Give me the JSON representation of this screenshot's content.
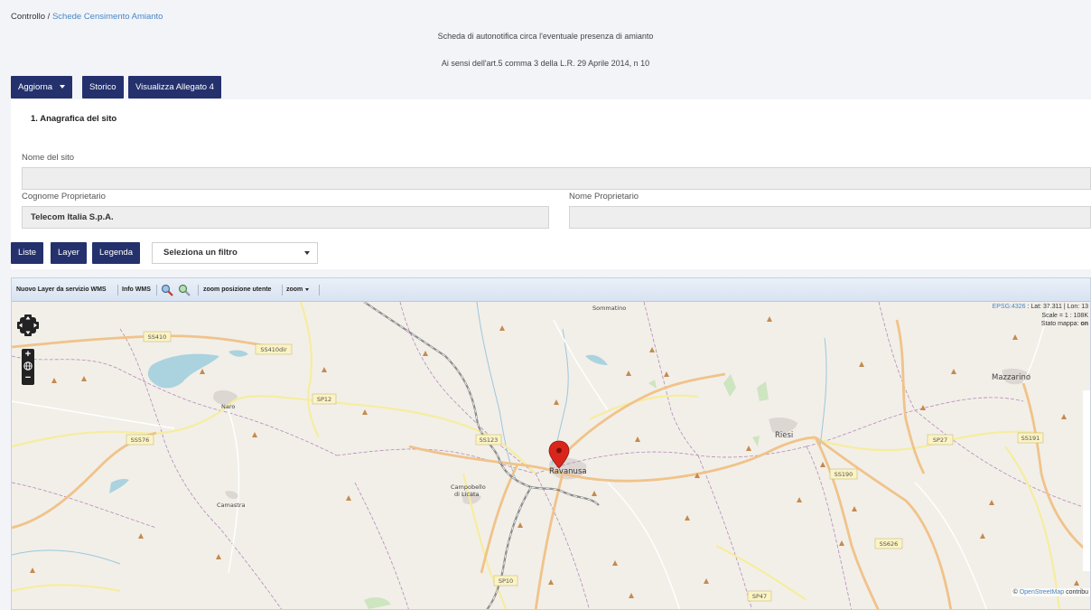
{
  "breadcrumb": {
    "root": "Controllo",
    "separator": " / ",
    "current": "Schede Censimento Amianto"
  },
  "header": {
    "title": "Scheda di autonotifica circa l'eventuale presenza di amianto",
    "subtitle": "Ai sensi dell'art.5 comma 3 della L.R. 29 Aprile 2014, n 10"
  },
  "toolbar": {
    "aggiorna": "Aggiorna",
    "storico": "Storico",
    "allegato": "Visualizza Allegato 4"
  },
  "section": {
    "title": "1. Anagrafica del sito"
  },
  "form": {
    "nome_sito_label": "Nome del sito",
    "nome_sito_value": "",
    "cognome_label": "Cognome Proprietario",
    "cognome_value": "Telecom Italia S.p.A.",
    "nome_label": "Nome Proprietario",
    "nome_value": ""
  },
  "map_controls": {
    "liste": "Liste",
    "layer": "Layer",
    "legenda": "Legenda",
    "filter_selected": "Seleziona un filtro"
  },
  "map_toolbar": {
    "wms_layer": "Nuovo Layer da servizio WMS",
    "info_wms": "Info WMS",
    "zoom_user": "zoom posizione utente",
    "zoom": "zoom"
  },
  "map_info": {
    "epsg": "EPSG:4326",
    "coords": " : Lat: 37.311 | Lon: 13",
    "scale": "Scale = 1 : 108K",
    "state_label": "Stato mappa: ",
    "state_value": "on"
  },
  "attribution": {
    "symbol": "© ",
    "osm": "OpenStreetMap",
    "rest": " contribu"
  },
  "map_places": {
    "sommatino": "Sommatino",
    "naro": "Naro",
    "riesi": "Riesi",
    "mazzarino": "Mazzarino",
    "ravanusa": "Ravanusa",
    "campobello1": "Campobello",
    "campobello2": "di Licata",
    "camastra": "Camastra"
  },
  "map_roads": {
    "ss410": "SS410",
    "ss410dir": "SS410dir",
    "sp12": "SP12",
    "ss576": "SS576",
    "ss123": "SS123",
    "sp27": "SP27",
    "ss191": "SS191",
    "ss190": "SS190",
    "ss626": "SS626",
    "sp10": "SP10",
    "sp47": "SP47"
  },
  "colors": {
    "button": "#24316d",
    "link": "#4a86c5",
    "marker": "#d9261c",
    "road_major": "#f0c38a",
    "road_minor": "#f6f0a6"
  }
}
